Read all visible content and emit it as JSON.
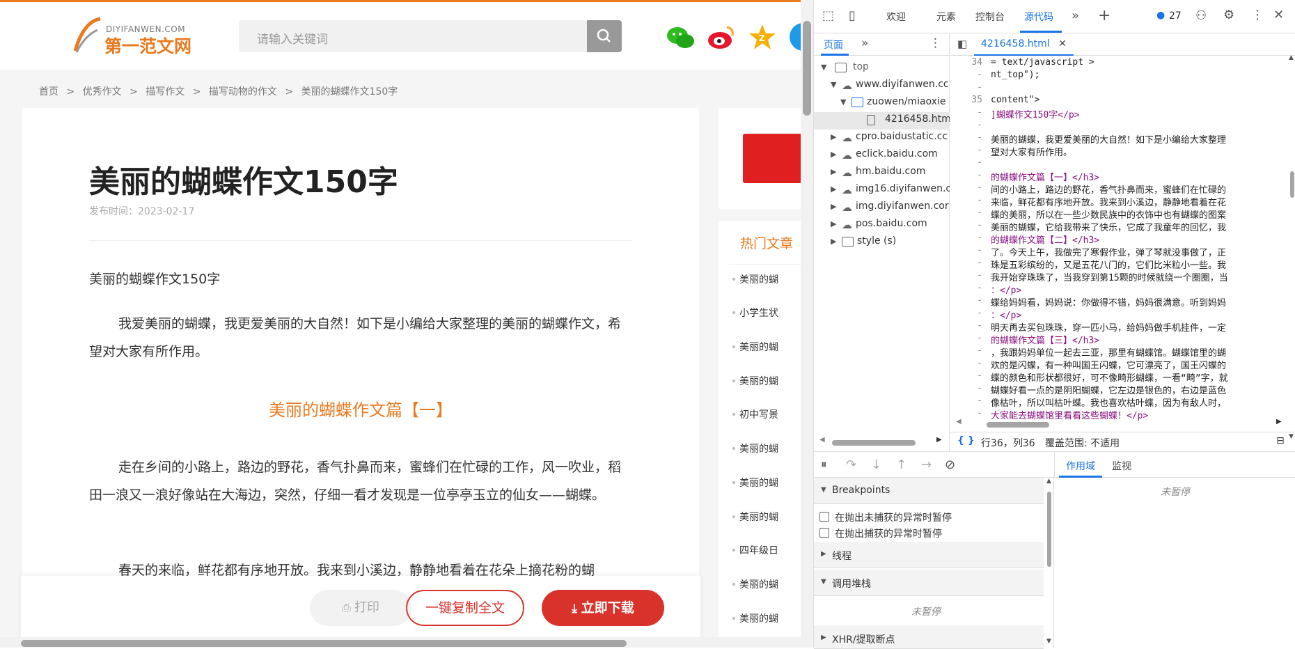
{
  "site": {
    "logo_domain": "DIYIFANWEN.COM",
    "logo_name": "第一范文网",
    "search_placeholder": "请输入关键词",
    "breadcrumb": [
      "首页",
      ">",
      "优秀作文",
      ">",
      "描写作文",
      ">",
      "描写动物的作文",
      ">",
      "美丽的蝴蝶作文150字"
    ]
  },
  "article": {
    "title": "美丽的蝴蝶作文150字",
    "date": "发布时间：2023-02-17",
    "lead": "美丽的蝴蝶作文150字",
    "intro": "我爱美丽的蝴蝶，我更爱美丽的大自然！如下是小编给大家整理的美丽的蝴蝶作文，希望对大家有所作用。",
    "section1": "美丽的蝴蝶作文篇【一】",
    "para1": "走在乡间的小路上，路边的野花，香气扑鼻而来，蜜蜂们在忙碌的工作，风一吹业，稻田一浪又一浪好像站在大海边，突然，仔细一看才发现是一位亭亭玉立的仙女——蝴蝶。",
    "para2": "春天的来临，鲜花都有序地开放。我来到小溪边，静静地看着在花朵上摘花粉的蝴"
  },
  "actions": {
    "print": "打印",
    "copy": "一键复制全文",
    "download": "立即下载"
  },
  "hot": {
    "title": "热门文章",
    "items": [
      "美丽的蝴",
      "小学生状",
      "美丽的蝴",
      "美丽的蝴",
      "初中写景",
      "美丽的蝴",
      "美丽的蝴",
      "美丽的蝴",
      "四年级日",
      "美丽的蝴",
      "美丽的蝴"
    ]
  },
  "devtools": {
    "tabs": [
      "欢迎",
      "元素",
      "控制台",
      "源代码"
    ],
    "issues_count": "27",
    "nav_tab": "页面",
    "tree": [
      {
        "label": "top"
      },
      {
        "label": "www.diyifanwen.cc"
      },
      {
        "label": "zuowen/miaoxie"
      },
      {
        "label": "4216458.html"
      },
      {
        "label": "cpro.baidustatic.cc"
      },
      {
        "label": "eclick.baidu.com"
      },
      {
        "label": "hm.baidu.com"
      },
      {
        "label": "img16.diyifanwen.c"
      },
      {
        "label": "img.diyifanwen.cor"
      },
      {
        "label": "pos.baidu.com"
      },
      {
        "label": "style (s)"
      }
    ],
    "file_tab": "4216458.html",
    "code_lines": [
      {
        "n": "34",
        "t": "= text/javascript >"
      },
      {
        "n": "-",
        "t": "nt_top\");"
      },
      {
        "n": "-",
        "t": ""
      },
      {
        "n": "35",
        "t": "content\">"
      },
      {
        "n": "-",
        "t": "]蝴蝶作文150字</p>"
      },
      {
        "n": "-",
        "t": ""
      },
      {
        "n": "-",
        "t": "美丽的蝴蝶，我更爱美丽的大自然！如下是小编给大家整理"
      },
      {
        "n": "-",
        "t": "望对大家有所作用。"
      },
      {
        "n": "-",
        "t": ""
      },
      {
        "n": "-",
        "t": "的蝴蝶作文篇【一】</h3>"
      },
      {
        "n": "-",
        "t": "间的小路上，路边的野花，香气扑鼻而来，蜜蜂们在忙碌的"
      },
      {
        "n": "-",
        "t": "来临，鲜花都有序地开放。我来到小溪边，静静地看着在花"
      },
      {
        "n": "-",
        "t": "蝶的美丽，所以在一些少数民族中的衣饰中也有蝴蝶的图案"
      },
      {
        "n": "-",
        "t": "美丽的蝴蝶，它给我带来了快乐，它成了我童年的回忆，我"
      },
      {
        "n": "-",
        "t": "的蝴蝶作文篇【二】</h3>"
      },
      {
        "n": "-",
        "t": "了。今天上午，我做完了寒假作业，弹了琴就没事做了，正"
      },
      {
        "n": "-",
        "t": "珠是五彩缤纷的，又是五花八门的，它们比米粒小一些。我"
      },
      {
        "n": "-",
        "t": "我开始穿珠珠了，当我穿到第15颗的时候就绕一个圈圈，当"
      },
      {
        "n": "-",
        "t": "：</p>"
      },
      {
        "n": "-",
        "t": "蝶给妈妈看，妈妈说：你做得不错，妈妈很满意。听到妈妈"
      },
      {
        "n": "-",
        "t": "：</p>"
      },
      {
        "n": "-",
        "t": "明天再去买包珠珠，穿一匹小马，给妈妈做手机挂件，一定"
      },
      {
        "n": "-",
        "t": "的蝴蝶作文篇【三】</h3>"
      },
      {
        "n": "-",
        "t": "，我跟妈妈单位一起去三亚，那里有蝴蝶馆。蝴蝶馆里的蝴"
      },
      {
        "n": "-",
        "t": "欢的是闪蝶，有一种叫国王闪蝶，它可漂亮了，国王闪蝶的"
      },
      {
        "n": "-",
        "t": "蝶的颜色和形状都很好，可不像畸形蝴蝶，一看“畸”字，就"
      },
      {
        "n": "-",
        "t": "蝴蝶好看一点的是阴阳蝴蝶，它左边是银色的，右边是蓝色"
      },
      {
        "n": "-",
        "t": "像枯叶，所以叫枯叶蝶。我也喜欢枯叶蝶，因为有敌人时，"
      },
      {
        "n": "-",
        "t": "大家能去蝴蝶馆里看看这些蝴蝶！</p>"
      }
    ],
    "status_pos": "行36，列36",
    "status_coverage": "覆盖范围: 不适用",
    "scope_tab": "作用域",
    "watch_tab": "监视",
    "not_paused": "未暂停",
    "breakpoints": "Breakpoints",
    "cb1": "在抛出未捕获的异常时暂停",
    "cb2": "在抛出捕获的异常时暂停",
    "threads": "线程",
    "callstack": "调用堆栈",
    "xhr": "XHR/提取断点"
  }
}
